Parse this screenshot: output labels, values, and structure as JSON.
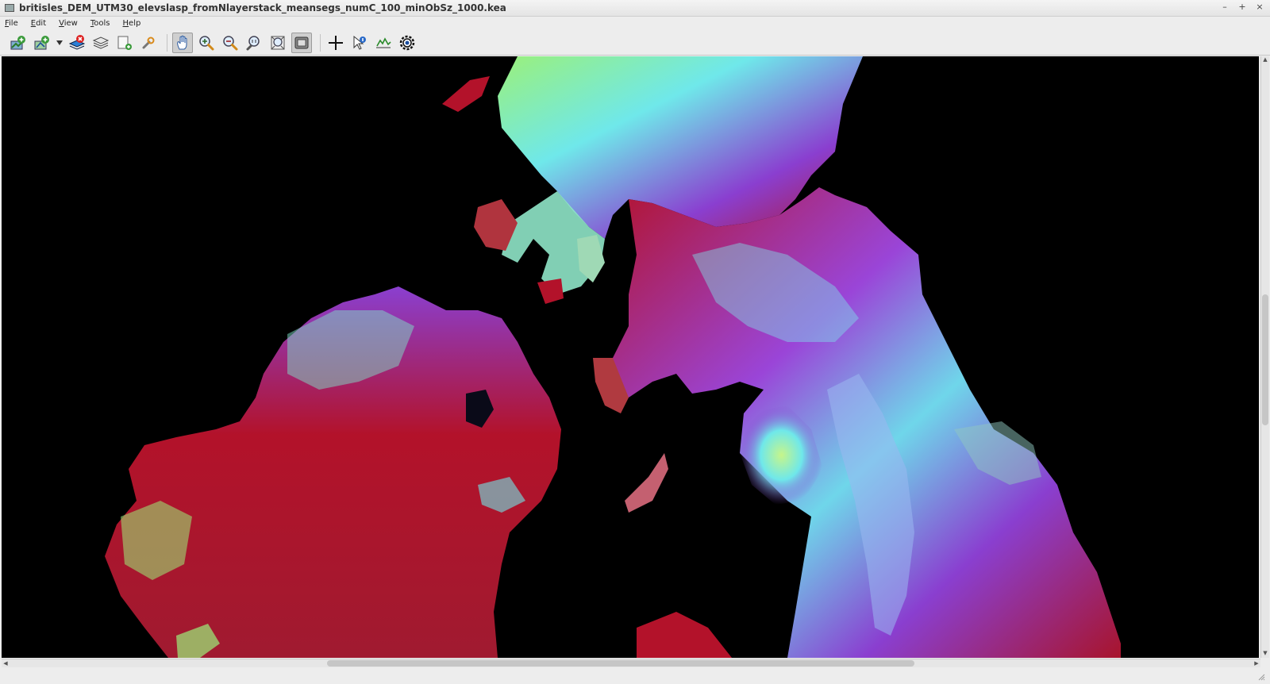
{
  "window": {
    "title": "britisles_DEM_UTM30_elevslasp_fromNlayerstack_meansegs_numC_100_minObSz_1000.kea",
    "controls": [
      "–",
      "+",
      "×"
    ]
  },
  "menu": [
    "File",
    "Edit",
    "View",
    "Tools",
    "Help"
  ],
  "toolbar": [
    {
      "name": "add-layer-icon"
    },
    {
      "name": "add-vector-icon"
    },
    {
      "name": "dropdown-arrow-icon"
    },
    {
      "name": "remove-layer-icon"
    },
    {
      "name": "layers-icon"
    },
    {
      "name": "new-window-icon"
    },
    {
      "name": "properties-wrench-icon"
    },
    {
      "name": "pan-hand-icon",
      "active": true
    },
    {
      "name": "zoom-in-icon"
    },
    {
      "name": "zoom-out-icon"
    },
    {
      "name": "zoom-native-icon"
    },
    {
      "name": "zoom-full-extent-icon"
    },
    {
      "name": "follow-extent-icon",
      "active": true
    },
    {
      "name": "crosshair-icon"
    },
    {
      "name": "query-point-icon"
    },
    {
      "name": "profile-icon"
    },
    {
      "name": "view-settings-eye-icon"
    }
  ],
  "colors": {
    "map_background": "#000000",
    "terrain_low": "#b3122a",
    "terrain_mid": "#8a3fd0",
    "terrain_high": "#6fe8ea",
    "terrain_peak": "#9bf07a"
  }
}
